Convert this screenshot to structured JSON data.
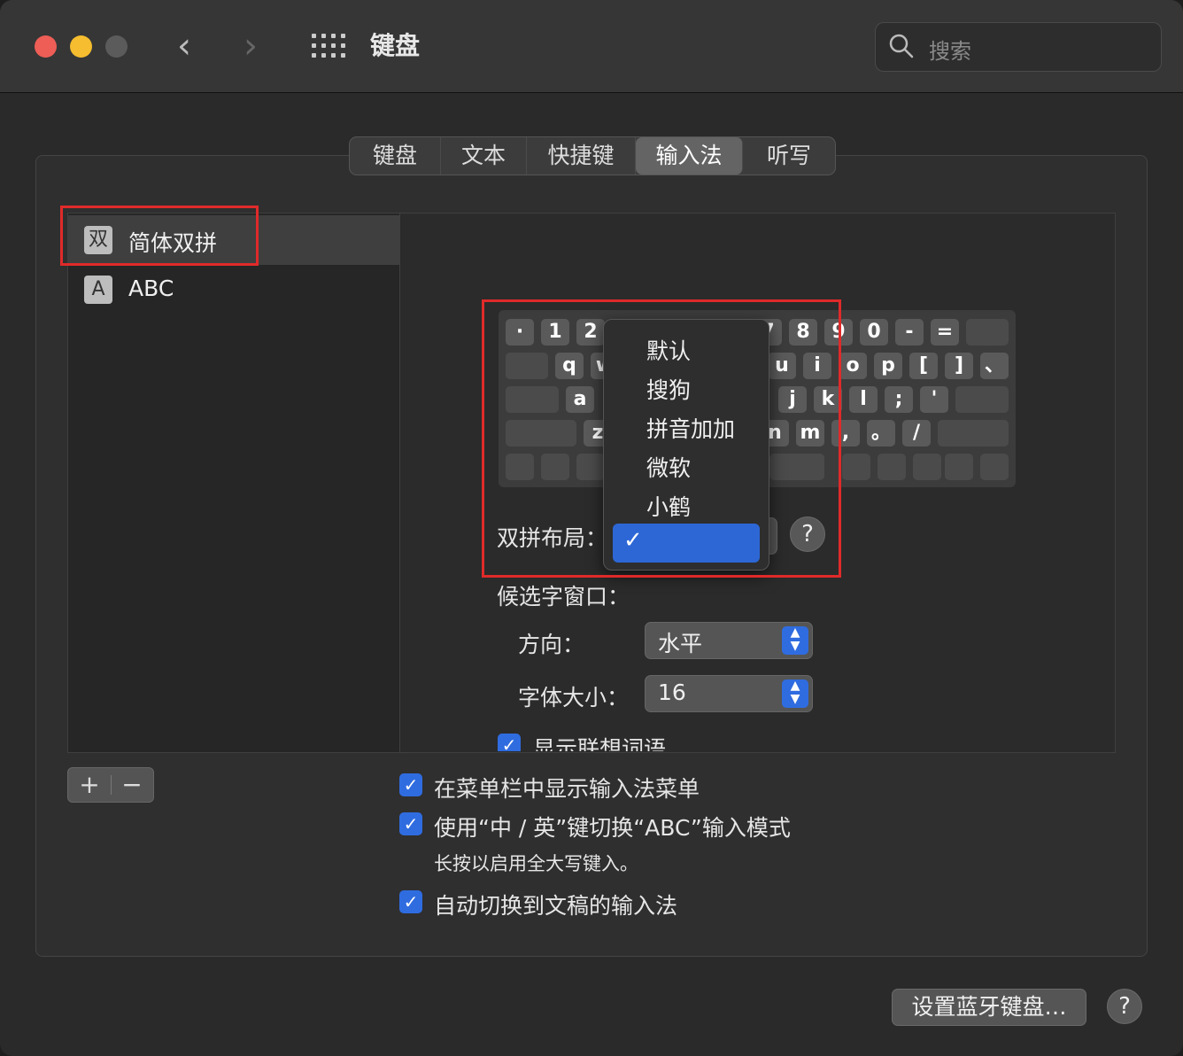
{
  "window": {
    "title": "键盘"
  },
  "search": {
    "placeholder": "搜索"
  },
  "tabs": [
    {
      "label": "键盘"
    },
    {
      "label": "文本"
    },
    {
      "label": "快捷键"
    },
    {
      "label": "输入法",
      "active": true
    },
    {
      "label": "听写"
    }
  ],
  "input_sources": [
    {
      "badge": "双",
      "label": "简体双拼",
      "selected": true
    },
    {
      "badge": "A",
      "label": "ABC"
    }
  ],
  "keyboard": {
    "row1": [
      "·",
      "1",
      "2",
      "7",
      "8",
      "9",
      "0",
      "-",
      "="
    ],
    "row2": [
      "q",
      "w",
      "u",
      "i",
      "o",
      "p",
      "[",
      "]",
      "、"
    ],
    "row3": [
      "a",
      "j",
      "k",
      "l",
      ";",
      "'"
    ],
    "row4": [
      "z",
      "n",
      "m",
      ",",
      "。",
      "/"
    ]
  },
  "layout_popup": {
    "options": [
      "默认",
      "搜狗",
      "拼音加加",
      "微软",
      "小鹤",
      ""
    ],
    "selected_index": 5,
    "check": "✓"
  },
  "settings": {
    "shuangpin_label": "双拼布局：",
    "candidate_label": "候选字窗口：",
    "direction_label": "方向：",
    "direction_value": "水平",
    "fontsize_label": "字体大小：",
    "fontsize_value": "16",
    "predictive_label": "显示联想词语"
  },
  "footer_checks": {
    "menu_bar": "在菜单栏中显示输入法菜单",
    "zh_en_key": "使用“中 / 英”键切换“ABC”输入模式",
    "zh_en_hint": "长按以启用全大写键入。",
    "auto_switch": "自动切换到文稿的输入法"
  },
  "buttons": {
    "add": "+",
    "remove": "−",
    "bluetooth": "设置蓝牙键盘…",
    "help": "?"
  },
  "colors": {
    "accent": "#2f6ce0",
    "highlight_box": "#e02a2a"
  }
}
